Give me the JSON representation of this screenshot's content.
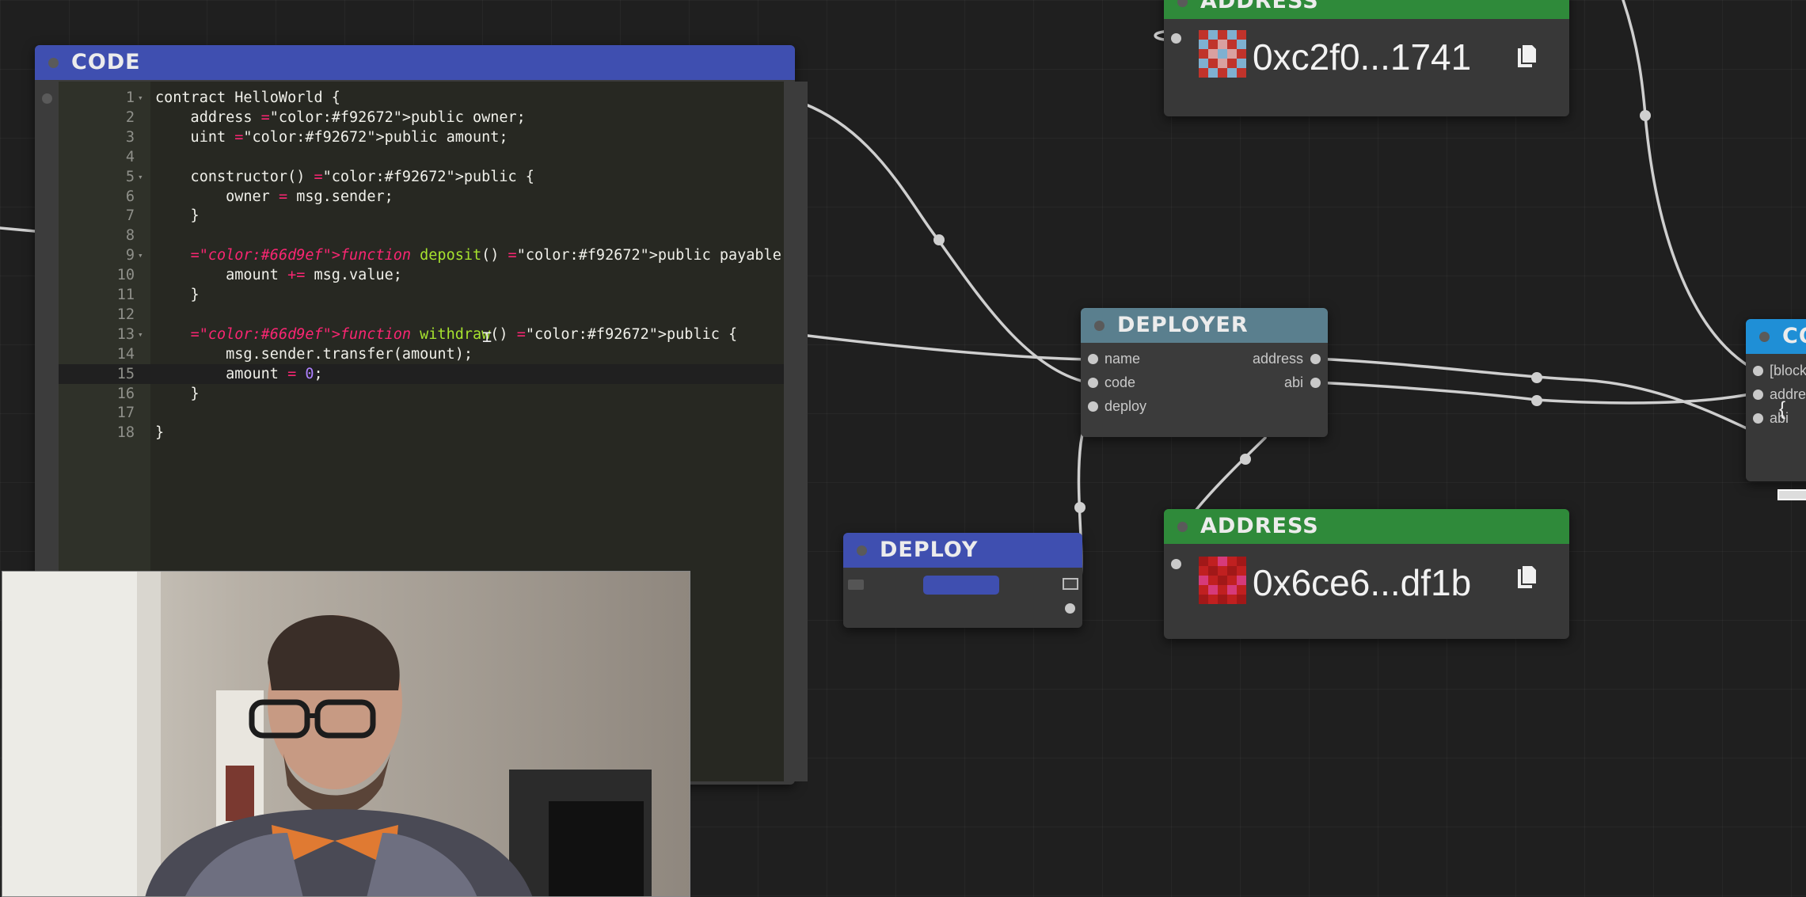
{
  "nodes": {
    "code": {
      "title": "CODE",
      "lines": [
        {
          "n": "1",
          "fold": "▾",
          "text": "contract HelloWorld {"
        },
        {
          "n": "2",
          "fold": "",
          "text": "    address public owner;"
        },
        {
          "n": "3",
          "fold": "",
          "text": "    uint public amount;"
        },
        {
          "n": "4",
          "fold": "",
          "text": ""
        },
        {
          "n": "5",
          "fold": "▾",
          "text": "    constructor() public {"
        },
        {
          "n": "6",
          "fold": "",
          "text": "        owner = msg.sender;"
        },
        {
          "n": "7",
          "fold": "",
          "text": "    }"
        },
        {
          "n": "8",
          "fold": "",
          "text": ""
        },
        {
          "n": "9",
          "fold": "▾",
          "text": "    function deposit() public payable {"
        },
        {
          "n": "10",
          "fold": "",
          "text": "        amount += msg.value;"
        },
        {
          "n": "11",
          "fold": "",
          "text": "    }"
        },
        {
          "n": "12",
          "fold": "",
          "text": ""
        },
        {
          "n": "13",
          "fold": "▾",
          "text": "    function withdraw() public {"
        },
        {
          "n": "14",
          "fold": "",
          "text": "        msg.sender.transfer(amount);"
        },
        {
          "n": "15",
          "fold": "",
          "text": "        amount = 0;"
        },
        {
          "n": "16",
          "fold": "",
          "text": "    }"
        },
        {
          "n": "17",
          "fold": "",
          "text": ""
        },
        {
          "n": "18",
          "fold": "",
          "text": "}"
        }
      ],
      "active_line": "15"
    },
    "deployer": {
      "title": "DEPLOYER",
      "inputs": [
        "name",
        "code",
        "deploy"
      ],
      "outputs": [
        "address",
        "abi"
      ]
    },
    "deploy": {
      "title": "DEPLOY"
    },
    "address_top": {
      "title": "ADDRESS",
      "value": "0xc2f0...1741"
    },
    "address_bottom": {
      "title": "ADDRESS",
      "value": "0x6ce6...df1b"
    },
    "contract_partial": {
      "title": "CO",
      "inputs": [
        "[block",
        "addre",
        "abi"
      ],
      "brace": "{"
    }
  },
  "colors": {
    "code_header": "#3f4fb0",
    "deployer_header": "#5a7f8e",
    "address_header": "#2f8a3a",
    "contract_header": "#1f8fd6",
    "keyword": "#f92672",
    "function_kw": "#66d9ef",
    "function_name": "#a6e22e",
    "number": "#ae81ff"
  },
  "icons": [
    "copy-icon",
    "identicon",
    "text-cursor-icon"
  ]
}
